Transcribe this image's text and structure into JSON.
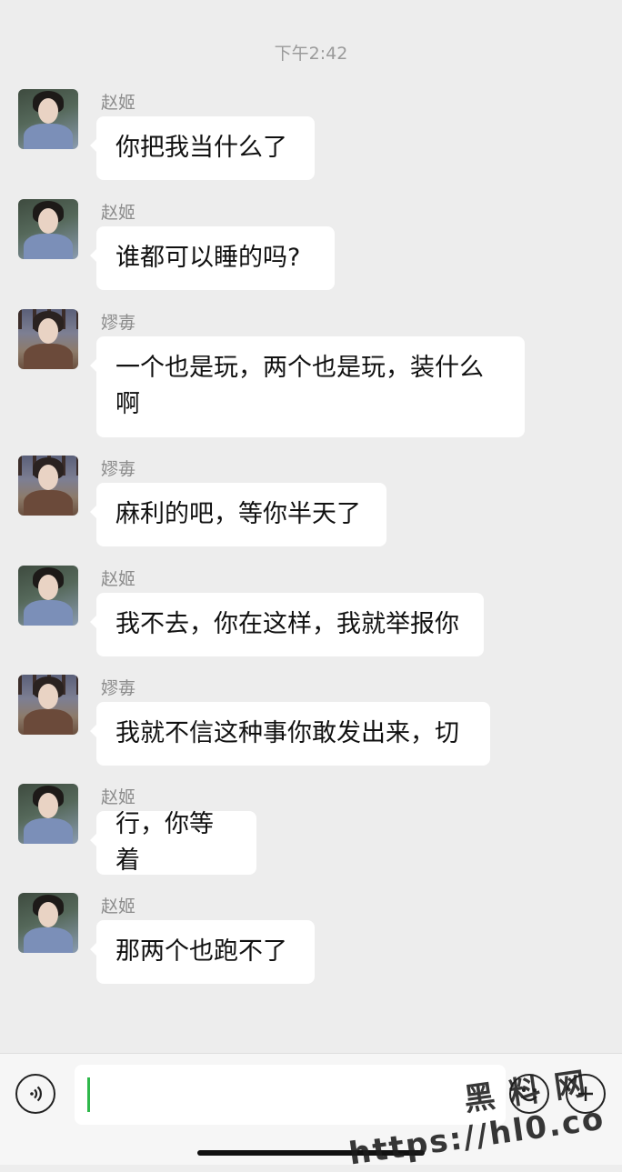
{
  "timestamp": "下午2:42",
  "messages": [
    {
      "sender": "赵姬",
      "avatar": "zhao",
      "text": "你把我当什么了"
    },
    {
      "sender": "赵姬",
      "avatar": "zhao",
      "text": "谁都可以睡的吗?"
    },
    {
      "sender": "嫪毐",
      "avatar": "lao",
      "text": "一个也是玩，两个也是玩，装什么啊"
    },
    {
      "sender": "嫪毐",
      "avatar": "lao",
      "text": "麻利的吧，等你半天了"
    },
    {
      "sender": "赵姬",
      "avatar": "zhao",
      "text": "我不去，你在这样，我就举报你"
    },
    {
      "sender": "嫪毐",
      "avatar": "lao",
      "text": "我就不信这种事你敢发出来，切"
    },
    {
      "sender": "赵姬",
      "avatar": "zhao",
      "text": "行，你等着"
    },
    {
      "sender": "赵姬",
      "avatar": "zhao",
      "text": "那两个也跑不了"
    }
  ],
  "input": {
    "value": ""
  },
  "watermark": {
    "line1": "黑料网",
    "line2": "https://hl0.co"
  },
  "colors": {
    "background": "#ededed",
    "bubble": "#ffffff",
    "cursor": "#2fb84b"
  },
  "icons": {
    "voice": "voice-icon",
    "emoji": "emoji-icon",
    "more": "plus-icon"
  }
}
